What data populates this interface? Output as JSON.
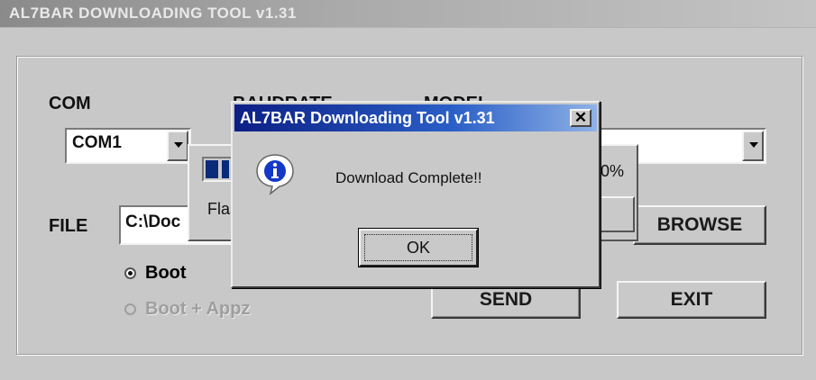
{
  "window": {
    "title": "AL7BAR DOWNLOADING TOOL v1.31"
  },
  "colors": {
    "dialog_title_start": "#0c1f85",
    "dialog_title_end": "#8fb2e6",
    "progress_fill": "#0a2a7a",
    "face": "#c9c9c9"
  },
  "com": {
    "label": "COM",
    "value": "COM1"
  },
  "baudrate": {
    "label": "BAUDRATE"
  },
  "model": {
    "label": "MODEL",
    "value": ""
  },
  "file": {
    "label": "FILE",
    "value": "C:\\Doc"
  },
  "buttons": {
    "browse": "BROWSE",
    "send": "SEND",
    "exit": "EXIT"
  },
  "options": {
    "boot": "Boot",
    "boot_appz": "Boot + Appz",
    "selected": "Boot"
  },
  "progress": {
    "percent_text": "0%",
    "status_text": "Flas",
    "fill_fraction": 0.06
  },
  "dialog": {
    "title": "AL7BAR Downloading Tool v1.31",
    "close_glyph": "✕",
    "message": "Download Complete!!",
    "ok_label": "OK",
    "icon": "info-icon"
  }
}
